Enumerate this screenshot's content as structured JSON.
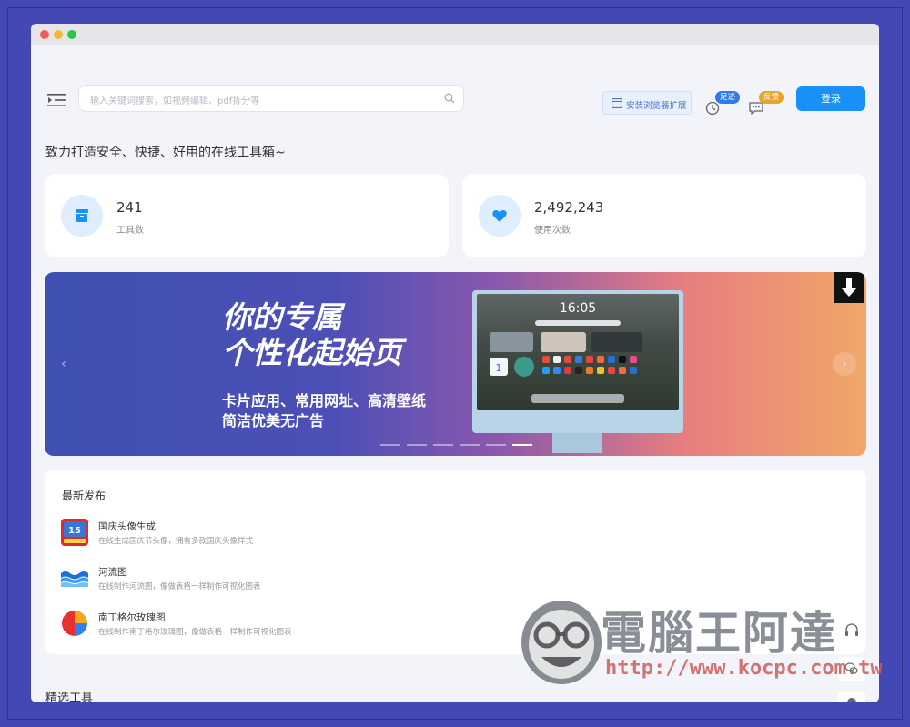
{
  "search": {
    "placeholder": "输入关键词搜索，如视频编辑、pdf拆分等"
  },
  "header": {
    "extension_label": "安装浏览器扩展",
    "footprint_badge": "足迹",
    "feedback_badge": "反馈",
    "login_label": "登录"
  },
  "tagline": "致力打造安全、快捷、好用的在线工具箱~",
  "stats": [
    {
      "value": "241",
      "label": "工具数"
    },
    {
      "value": "2,492,243",
      "label": "使用次数"
    }
  ],
  "banner": {
    "title_line1": "你的专属",
    "title_line2": "个性化起始页",
    "subtitle_line1": "卡片应用、常用网址、高清壁纸",
    "subtitle_line2": "简洁优美无广告",
    "clock": "16:05",
    "slide_count": 6,
    "active_slide": 6
  },
  "latest": {
    "title": "最新发布",
    "items": [
      {
        "name": "国庆头像生成",
        "desc": "在线生成国庆节头像，拥有多款国庆头像样式"
      },
      {
        "name": "河流图",
        "desc": "在线制作河流图，像做表格一样制作可视化图表"
      },
      {
        "name": "南丁格尔玫瑰图",
        "desc": "在线制作南丁格尔玫瑰图，像做表格一样制作可视化图表"
      }
    ]
  },
  "featured_title": "精选工具",
  "watermark": {
    "text": "電腦王阿達",
    "url": "http://www.kocpc.com.tw"
  },
  "colors": {
    "accent": "#1890f7",
    "background": "#f3f4fa",
    "frame": "#4348b4"
  }
}
